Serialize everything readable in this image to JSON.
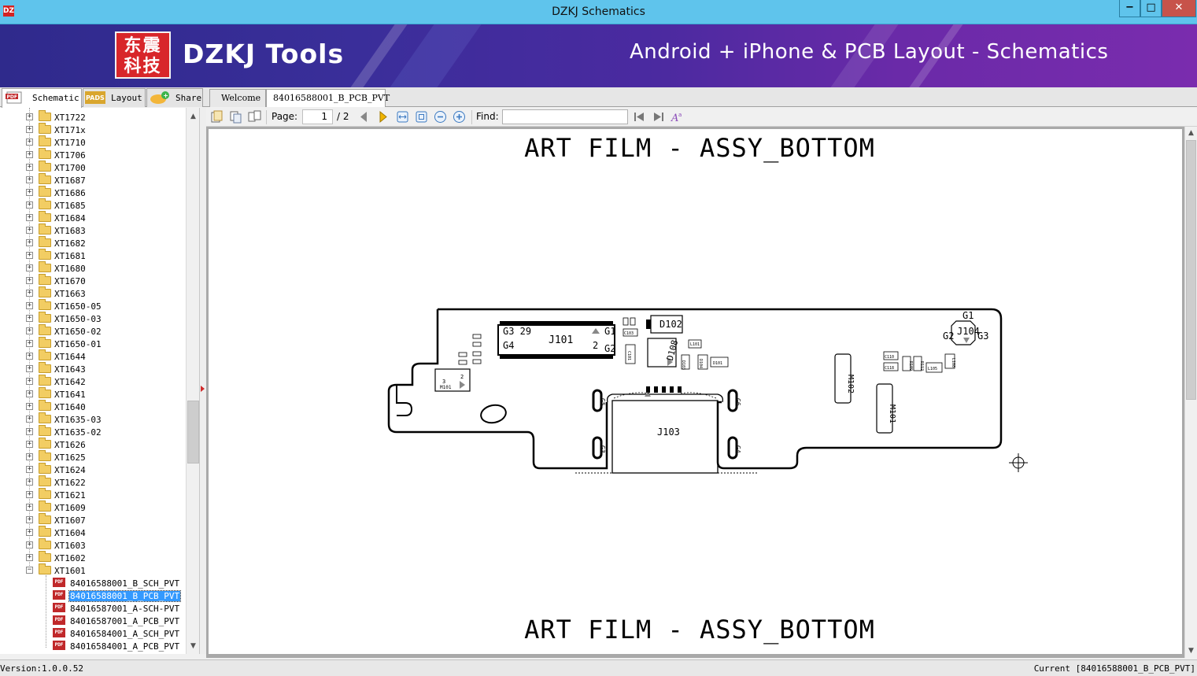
{
  "window": {
    "title": "DZKJ Schematics",
    "min_label": "−",
    "max_label": "□",
    "close_label": "✕"
  },
  "banner": {
    "logo_line1": "东震",
    "logo_line2": "科技",
    "brand": "DZKJ Tools",
    "tagline": "Android + iPhone & PCB Layout - Schematics"
  },
  "left_tabs": [
    {
      "label": "Schematic",
      "icon": "pdf-icon",
      "active": true
    },
    {
      "label": "Layout",
      "icon": "pads-icon",
      "active": false
    },
    {
      "label": "Share",
      "icon": "cloud-share-icon",
      "active": false
    }
  ],
  "doc_tabs": [
    {
      "label": "Welcome",
      "active": false
    },
    {
      "label": "84016588001_B_PCB_PVT",
      "active": true,
      "close": "✕"
    }
  ],
  "tree": {
    "folders": [
      "XT1722",
      "XT171x",
      "XT1710",
      "XT1706",
      "XT1700",
      "XT1687",
      "XT1686",
      "XT1685",
      "XT1684",
      "XT1683",
      "XT1682",
      "XT1681",
      "XT1680",
      "XT1670",
      "XT1663",
      "XT1650-05",
      "XT1650-03",
      "XT1650-02",
      "XT1650-01",
      "XT1644",
      "XT1643",
      "XT1642",
      "XT1641",
      "XT1640",
      "XT1635-03",
      "XT1635-02",
      "XT1626",
      "XT1625",
      "XT1624",
      "XT1622",
      "XT1621",
      "XT1609",
      "XT1607",
      "XT1604",
      "XT1603",
      "XT1602"
    ],
    "open_folder": "XT1601",
    "files": [
      {
        "name": "84016588001_B_SCH_PVT",
        "selected": false
      },
      {
        "name": "84016588001_B_PCB_PVT",
        "selected": true
      },
      {
        "name": "84016587001_A-SCH-PVT",
        "selected": false
      },
      {
        "name": "84016587001_A_PCB_PVT",
        "selected": false
      },
      {
        "name": "84016584001_A_SCH_PVT",
        "selected": false
      },
      {
        "name": "84016584001_A_PCB_PVT",
        "selected": false
      }
    ],
    "pdf_badge": "PDF"
  },
  "toolbar": {
    "page_label": "Page:",
    "page_current": "1",
    "page_total": "/ 2",
    "find_label": "Find:",
    "find_value": ""
  },
  "document": {
    "heading_top": "ART FILM - ASSY_BOTTOM",
    "heading_bottom": "ART FILM - ASSY_BOTTOM",
    "labels": {
      "g3_29": "G3 29",
      "j101": "J101",
      "g1_a": "G1",
      "g4": "G4",
      "two": "2",
      "g2_a": "G2",
      "d102": "D102",
      "d108": "D108",
      "c103": "C103",
      "c101": "C101",
      "d103": "D103",
      "d104": "D104",
      "d101": "D101",
      "l101": "L101",
      "m101": "M101",
      "m101_three": "3",
      "m101_two": "2",
      "j103": "J103",
      "m102": "M102",
      "m101_right": "M101",
      "c110": "C110",
      "c118": "C118",
      "r109": "R109",
      "r112": "R112",
      "l105": "L105",
      "l108": "L108",
      "g1_b": "G1",
      "j104": "J104",
      "g2_b": "G2",
      "g3_b": "G3",
      "g_left_top": "G5",
      "g_left_bot": "G3",
      "g_right_top": "G6",
      "g_right_bot": "G4"
    }
  },
  "status": {
    "version": "Version:1.0.0.52",
    "current": "Current [84016588001_B_PCB_PVT]"
  },
  "colors": {
    "titlebar": "#5fc4ec",
    "selection": "#3399ff",
    "close_button": "#c7534a"
  }
}
